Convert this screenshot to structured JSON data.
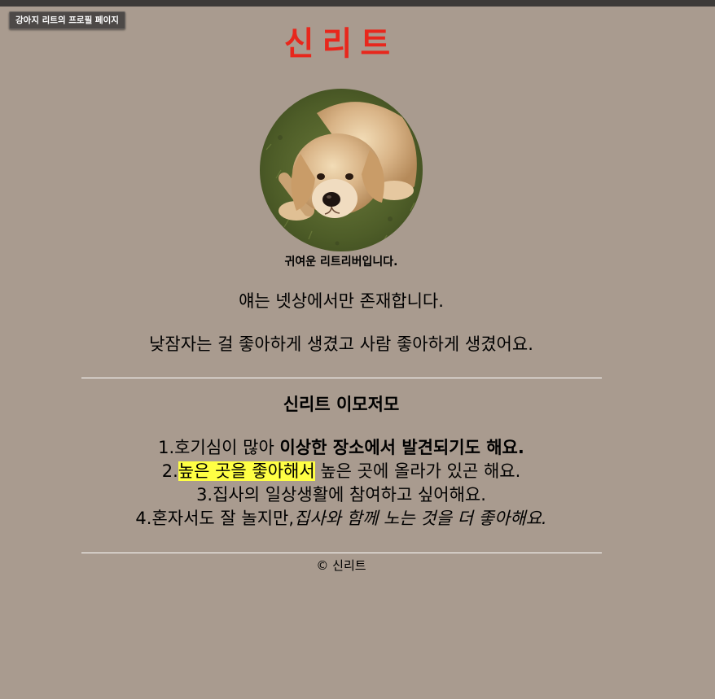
{
  "tab": {
    "label": "강아지 리트의 프로필 페이지"
  },
  "header": {
    "title": "신리트"
  },
  "profile": {
    "caption": "귀여운 리트리버입니다."
  },
  "intro": {
    "line1": "얘는 넷상에서만 존재합니다.",
    "line2": "낮잠자는 걸 좋아하게 생겼고 사람 좋아하게 생겼어요."
  },
  "facts": {
    "title": "신리트 이모저모",
    "items": [
      {
        "prefix": "1.호기심이 많아 ",
        "emphasis": "이상한 장소에서 발견되기도 해요."
      },
      {
        "prefix": "2.",
        "highlight": "높은 곳을 좋아해서",
        "rest": " 높은 곳에 올라가 있곤 해요."
      },
      {
        "text": "3.집사의 일상생활에 참여하고 싶어해요."
      },
      {
        "prefix": "4.혼자서도 잘 놀지만,",
        "italic": "집사와 함께 노는 것을 더 좋아해요."
      }
    ]
  },
  "footer": {
    "text": "© 신리트"
  },
  "colors": {
    "background": "#a99b8f",
    "title": "#e8271c",
    "highlight": "#ffff44",
    "topbar": "#3d3a38"
  },
  "icons": {
    "profile": "golden-retriever-photo"
  }
}
